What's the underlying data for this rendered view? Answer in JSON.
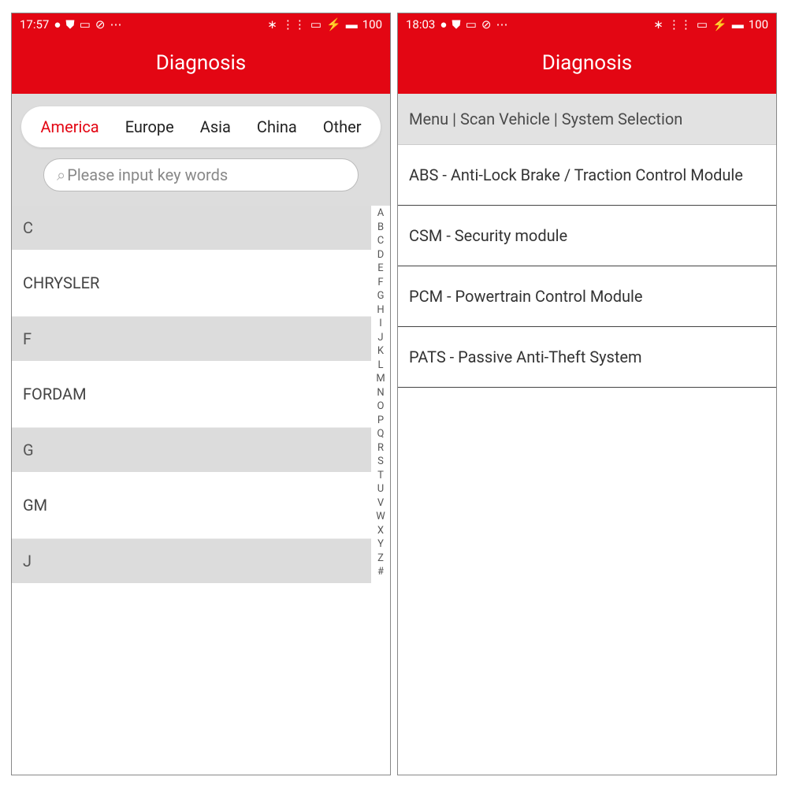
{
  "left": {
    "status": {
      "time": "17:57",
      "battery": "100"
    },
    "title": "Diagnosis",
    "tabs": [
      "America",
      "Europe",
      "Asia",
      "China",
      "Other"
    ],
    "active_tab_index": 0,
    "search_placeholder": "Please input key words",
    "sections": [
      {
        "letter": "C",
        "items": [
          "CHRYSLER"
        ]
      },
      {
        "letter": "F",
        "items": [
          "FORDAM"
        ]
      },
      {
        "letter": "G",
        "items": [
          "GM"
        ]
      },
      {
        "letter": "J",
        "items": []
      }
    ],
    "alpha": [
      "A",
      "B",
      "C",
      "D",
      "E",
      "F",
      "G",
      "H",
      "I",
      "J",
      "K",
      "L",
      "M",
      "N",
      "O",
      "P",
      "Q",
      "R",
      "S",
      "T",
      "U",
      "V",
      "W",
      "X",
      "Y",
      "Z",
      "#"
    ]
  },
  "right": {
    "status": {
      "time": "18:03",
      "battery": "100"
    },
    "title": "Diagnosis",
    "breadcrumb": "Menu | Scan Vehicle | System Selection",
    "systems": [
      "ABS - Anti-Lock Brake / Traction Control Module",
      "CSM - Security module",
      "PCM - Powertrain Control Module",
      "PATS - Passive Anti-Theft System"
    ]
  }
}
